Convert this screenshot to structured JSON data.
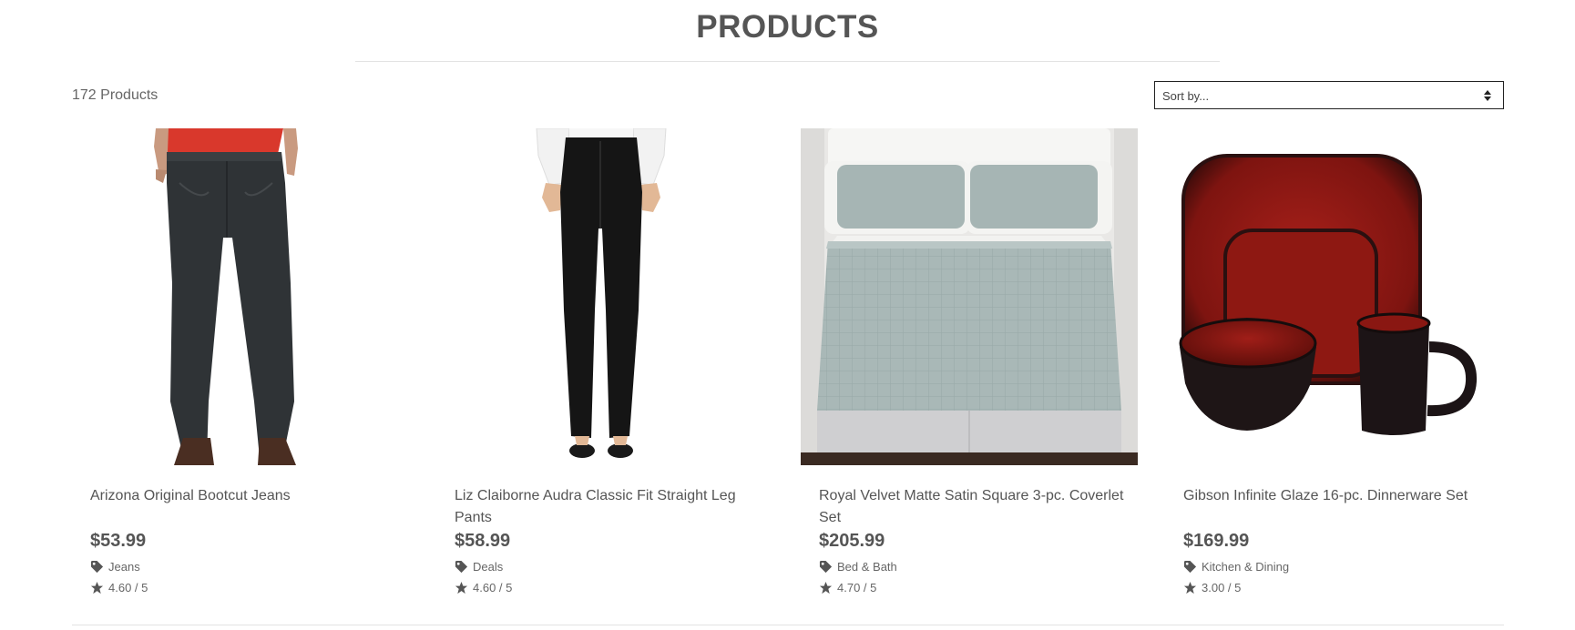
{
  "header": {
    "title": "PRODUCTS"
  },
  "toolbar": {
    "count_label": "172 Products",
    "sort_placeholder": "Sort by..."
  },
  "products": [
    {
      "name": "Arizona Original Bootcut Jeans",
      "price": "$53.99",
      "category": "Jeans",
      "rating": "4.60 / 5",
      "image": "jeans"
    },
    {
      "name": "Liz Claiborne Audra Classic Fit Straight Leg Pants",
      "price": "$58.99",
      "category": "Deals",
      "rating": "4.60 / 5",
      "image": "black-pants"
    },
    {
      "name": "Royal Velvet Matte Satin Square 3-pc. Coverlet Set",
      "price": "$205.99",
      "category": "Bed & Bath",
      "rating": "4.70 / 5",
      "image": "coverlet-bed"
    },
    {
      "name": "Gibson Infinite Glaze 16-pc. Dinnerware Set",
      "price": "$169.99",
      "category": "Kitchen & Dining",
      "rating": "3.00 / 5",
      "image": "red-dinnerware"
    }
  ],
  "icons": {
    "category": "tag-icon",
    "rating": "star-icon",
    "sort": "sort-arrows-icon"
  },
  "colors": {
    "text": "#555555",
    "rule": "#e3e3e3",
    "select_border": "#222222"
  }
}
